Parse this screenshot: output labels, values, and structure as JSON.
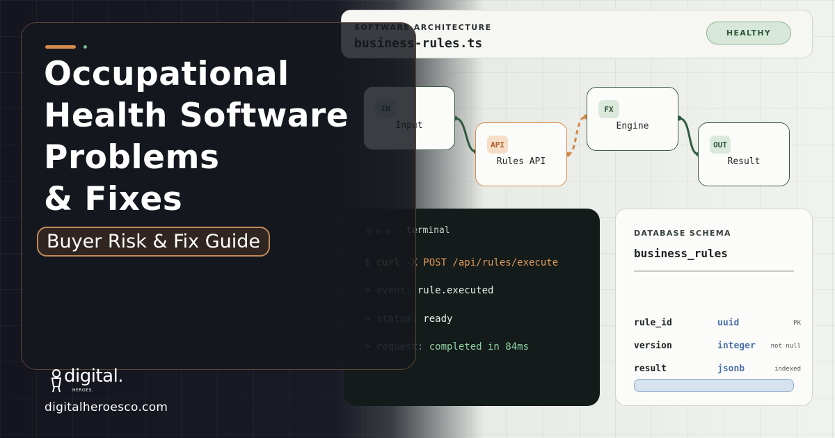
{
  "hero": {
    "title_lines": [
      "Occupational",
      "Health Software",
      "Problems",
      "& Fixes"
    ],
    "subtitle": "Buyer Risk & Fix Guide"
  },
  "architecture": {
    "label": "SOFTWARE ARCHITECTURE",
    "file": "business-rules.ts",
    "status": "HEALTHY"
  },
  "nodes": [
    {
      "badge": "IN",
      "label": "Input"
    },
    {
      "badge": "API",
      "label": "Rules API"
    },
    {
      "badge": "FX",
      "label": "Engine"
    },
    {
      "badge": "OUT",
      "label": "Result"
    }
  ],
  "terminal": {
    "title": "terminal",
    "lines": [
      {
        "key": "$ ",
        "value": "curl -X POST /api/rules/execute"
      },
      {
        "key": "> event: ",
        "value": "rule.executed"
      },
      {
        "key": "> status: ",
        "value": "ready"
      },
      {
        "key": "> request: ",
        "value": "completed in 84ms"
      }
    ]
  },
  "schema": {
    "label": "DATABASE SCHEMA",
    "table": "business_rules",
    "rows": [
      {
        "column": "rule_id",
        "type": "uuid",
        "flag": "PK"
      },
      {
        "column": "version",
        "type": "integer",
        "flag": "not null"
      },
      {
        "column": "result",
        "type": "jsonb",
        "flag": "indexed"
      }
    ]
  },
  "brand": {
    "logo_word": "digital.",
    "logo_sub": "HEROES.",
    "url": "digitalheroesco.com"
  },
  "colors": {
    "accent_orange": "#d58a4e",
    "accent_green": "#3f5a49",
    "schema_type": "#4a70a8"
  }
}
